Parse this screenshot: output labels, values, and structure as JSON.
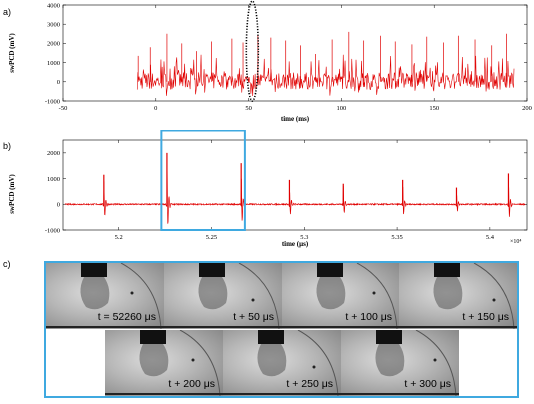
{
  "panel_labels": [
    "a)",
    "b)",
    "c)"
  ],
  "chart_data": [
    {
      "type": "line",
      "panel": "a)",
      "xlabel": "time (ms)",
      "ylabel": "swPCD (mV)",
      "xlim": [
        -50,
        200
      ],
      "ylim": [
        -1000,
        4000
      ],
      "xticks": [
        -50,
        0,
        50,
        100,
        150,
        200
      ],
      "yticks": [
        -1000,
        0,
        1000,
        2000,
        3000,
        4000
      ],
      "grid": false,
      "legend": "none",
      "series": [
        {
          "color": "#e00000",
          "signal_start_ms": -10,
          "signal_end_ms": 193,
          "baseline_mV": 0,
          "noise_range_mV": [
            -800,
            2600
          ],
          "x": [
            -9.5,
            -3,
            6,
            14,
            22,
            30,
            41,
            47,
            55,
            62,
            70,
            78,
            86,
            95,
            104,
            112,
            121,
            129,
            138,
            146,
            155,
            163,
            172,
            181,
            189
          ],
          "y": [
            1350,
            1800,
            2500,
            2000,
            1600,
            2100,
            2250,
            2050,
            2450,
            2300,
            2150,
            1900,
            1450,
            2200,
            2600,
            2150,
            2400,
            2100,
            1950,
            2350,
            2050,
            2400,
            2200,
            1900,
            2500
          ]
        }
      ],
      "annotation": {
        "shape": "dotted-ellipse",
        "center_x_ms": 52,
        "center_y_mV": 1600
      }
    },
    {
      "type": "line",
      "panel": "b)",
      "xlabel": "time (μs)",
      "ylabel": "swPCD (mV)",
      "xlim": [
        51700,
        54200
      ],
      "ylim": [
        -1000,
        2500
      ],
      "xticks": [
        52000,
        52500,
        53000,
        53500,
        54000
      ],
      "xtick_labels": [
        "5.2",
        "5.25",
        "5.3",
        "5.35",
        "5.4"
      ],
      "x_multiplier": "×10⁴",
      "yticks": [
        -1000,
        0,
        1000,
        2000
      ],
      "grid": false,
      "legend": "none",
      "series": [
        {
          "color": "#e00000",
          "x": [
            51920,
            52260,
            52660,
            52920,
            53210,
            53530,
            53820,
            54100
          ],
          "y": [
            1150,
            2000,
            1600,
            950,
            800,
            950,
            650,
            1200
          ]
        }
      ],
      "highlight_box": {
        "x_start": 52230,
        "x_end": 52680,
        "color": "#3fa9e0"
      }
    }
  ],
  "frames": {
    "border_color": "#3fa9e0",
    "label_color": "#000000",
    "labels": [
      "t = 52260 μs",
      "t + 50 μs",
      "t + 100 μs",
      "t + 150 μs",
      "t + 200 μs",
      "t + 250 μs",
      "t + 300 μs"
    ]
  }
}
